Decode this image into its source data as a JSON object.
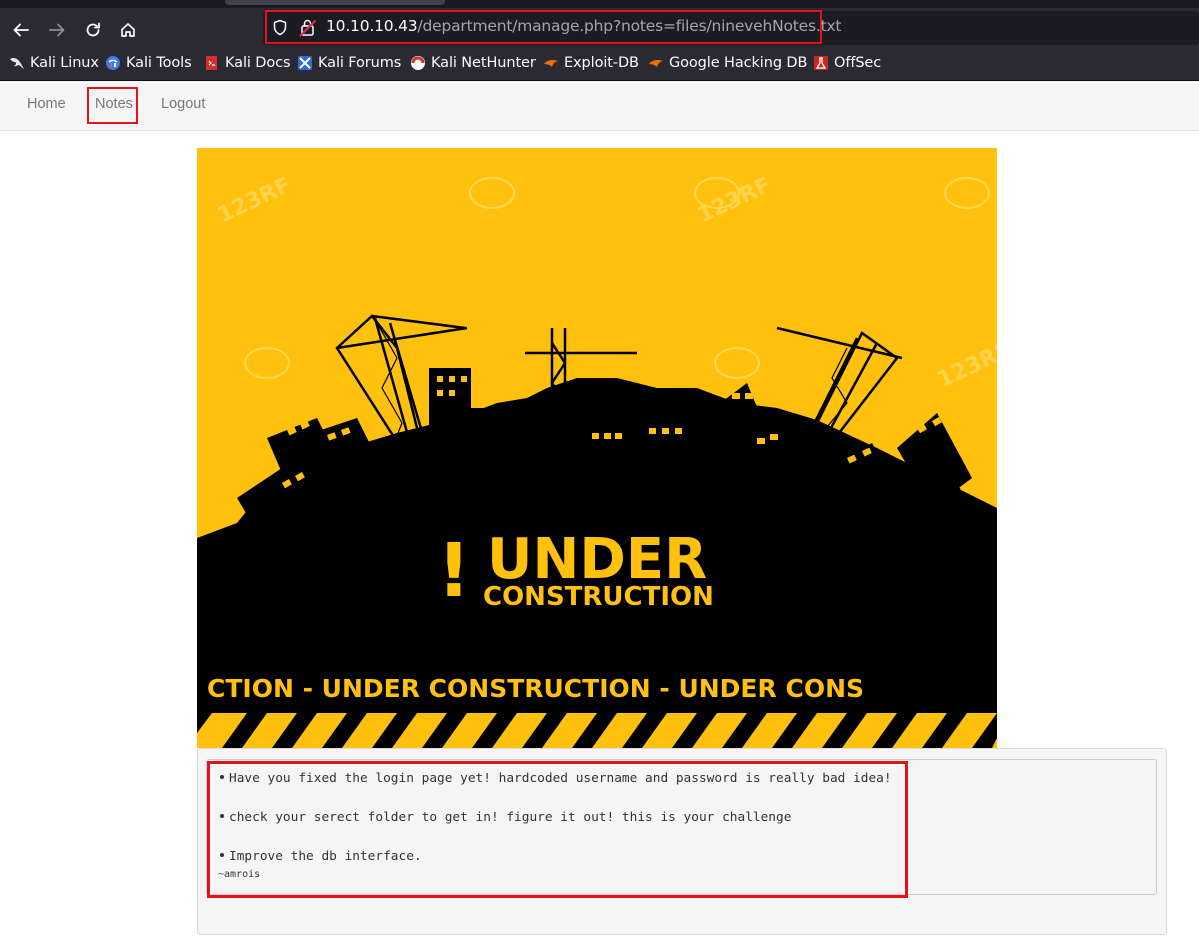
{
  "browser": {
    "url_host": "10.10.10.43",
    "url_path": "/department/manage.php?notes=files/ninevehNotes.txt",
    "bookmarks": [
      {
        "label": "Kali Linux",
        "icon": "kali-dragon-icon"
      },
      {
        "label": "Kali Tools",
        "icon": "kali-tools-icon"
      },
      {
        "label": "Kali Docs",
        "icon": "kali-docs-icon"
      },
      {
        "label": "Kali Forums",
        "icon": "kali-forums-icon"
      },
      {
        "label": "Kali NetHunter",
        "icon": "kali-nethunter-icon"
      },
      {
        "label": "Exploit-DB",
        "icon": "exploit-db-icon"
      },
      {
        "label": "Google Hacking DB",
        "icon": "ghdb-icon"
      },
      {
        "label": "OffSec",
        "icon": "offsec-icon"
      }
    ]
  },
  "nav": {
    "home": "Home",
    "notes": "Notes",
    "logout": "Logout"
  },
  "banner": {
    "title_mark": "!",
    "title_main": "UNDER",
    "title_sub": "CONSTRUCTION",
    "ribbon": "CTION - UNDER  CONSTRUCTION - UNDER  CONS",
    "watermark": "123RF"
  },
  "notes": {
    "line1": "Have you fixed the login page yet! hardcoded username and password is really bad idea!",
    "line2": "check your serect folder to get in! figure it out! this is your challenge",
    "line3": "Improve the db interface.",
    "signature": "~amrois"
  },
  "colors": {
    "highlight": "#e3131b",
    "banner_yellow": "#ffc10e",
    "banner_black": "#000000"
  }
}
